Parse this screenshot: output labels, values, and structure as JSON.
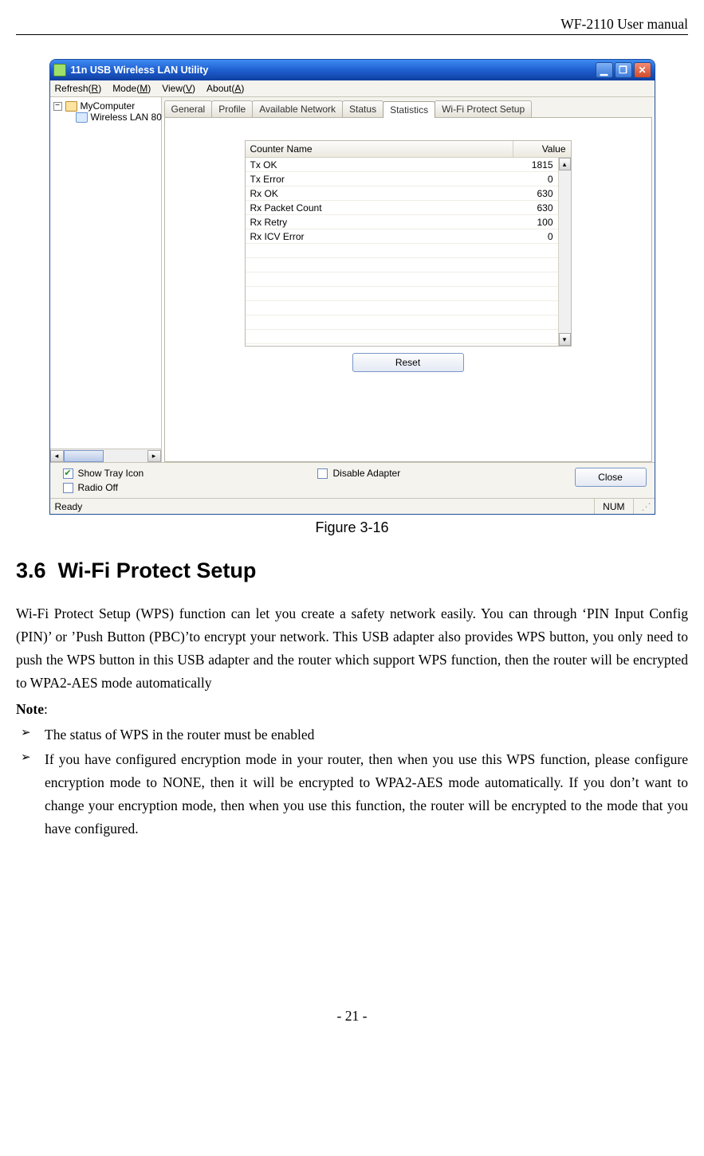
{
  "doc": {
    "header": "WF-2110 User manual",
    "page_number": "- 21 -",
    "figure_caption": "Figure 3-16",
    "section_number": "3.6",
    "section_title": "Wi-Fi Protect Setup",
    "paragraph": "Wi-Fi Protect Setup (WPS) function can let you create a safety network easily. You can through ‘PIN Input Config (PIN)’ or ’Push Button (PBC)’to encrypt your network. This USB adapter also provides WPS button, you only need to push the WPS button in this USB adapter and the router which support WPS function, then the router will be encrypted to WPA2-AES mode automatically",
    "note_label": "Note",
    "notes": [
      "The status of WPS in the router must be enabled",
      "If you have configured encryption mode in your router, then when you use this WPS function, please configure encryption mode to NONE, then it will be encrypted to WPA2-AES mode automatically. If you don’t want to change your encryption mode, then when you use this function, the router will be encrypted to the mode that you have configured."
    ]
  },
  "app": {
    "title": "11n USB Wireless LAN Utility",
    "menus": {
      "refresh": {
        "label": "Refresh(",
        "mnemonic": "R",
        "tail": ")"
      },
      "mode": {
        "label": "Mode(",
        "mnemonic": "M",
        "tail": ")"
      },
      "view": {
        "label": "View(",
        "mnemonic": "V",
        "tail": ")"
      },
      "about": {
        "label": "About(",
        "mnemonic": "A",
        "tail": ")"
      }
    },
    "tree": {
      "root": "MyComputer",
      "child": "Wireless LAN 80"
    },
    "tabs": {
      "general": "General",
      "profile": "Profile",
      "available": "Available Network",
      "status": "Status",
      "statistics": "Statistics",
      "wps": "Wi-Fi Protect Setup"
    },
    "stats": {
      "header_name": "Counter Name",
      "header_value": "Value",
      "rows": [
        {
          "name": "Tx OK",
          "value": "1815"
        },
        {
          "name": "Tx Error",
          "value": "0"
        },
        {
          "name": "Rx OK",
          "value": "630"
        },
        {
          "name": "Rx Packet Count",
          "value": "630"
        },
        {
          "name": "Rx Retry",
          "value": "100"
        },
        {
          "name": "Rx ICV Error",
          "value": "0"
        }
      ],
      "reset": "Reset"
    },
    "options": {
      "show_tray": "Show Tray Icon",
      "radio_off": "Radio Off",
      "disable_adapter": "Disable Adapter",
      "close": "Close"
    },
    "status": {
      "ready": "Ready",
      "num": "NUM"
    }
  },
  "chart_data": {
    "type": "table",
    "title": "Statistics",
    "columns": [
      "Counter Name",
      "Value"
    ],
    "rows": [
      [
        "Tx OK",
        1815
      ],
      [
        "Tx Error",
        0
      ],
      [
        "Rx OK",
        630
      ],
      [
        "Rx Packet Count",
        630
      ],
      [
        "Rx Retry",
        100
      ],
      [
        "Rx ICV Error",
        0
      ]
    ]
  }
}
